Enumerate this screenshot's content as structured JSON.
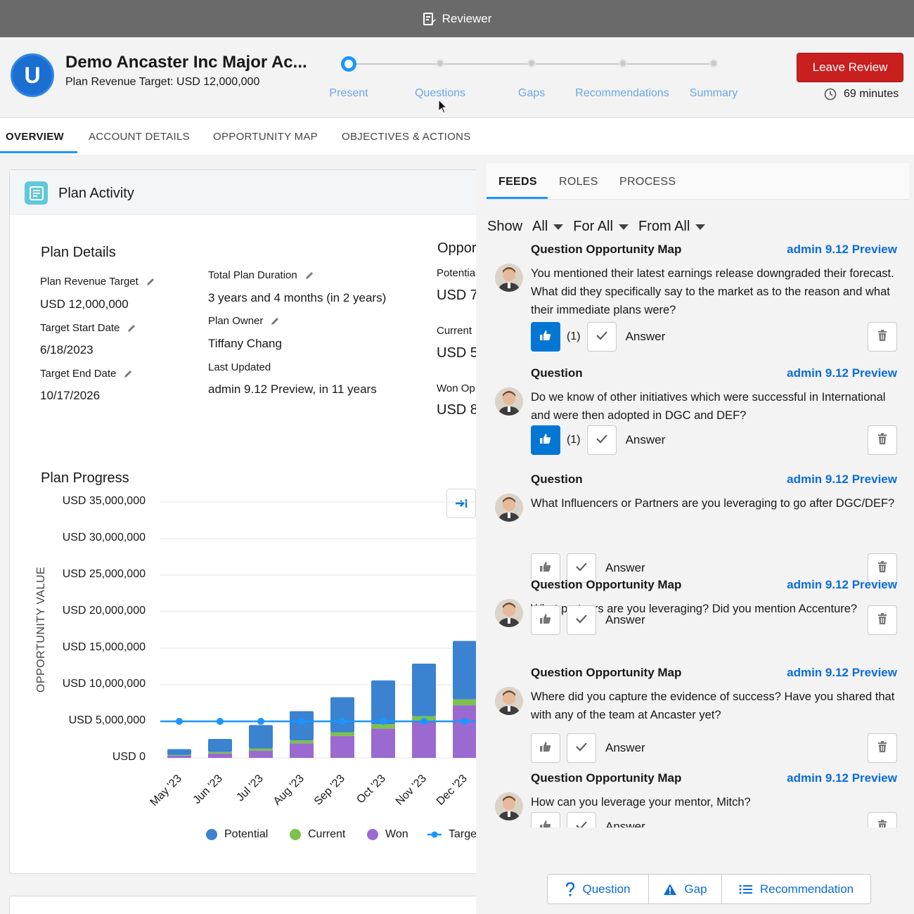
{
  "window": {
    "title": "Reviewer"
  },
  "header": {
    "logo_letter": "U",
    "account_title": "Demo Ancaster Inc Major Ac...",
    "subtitle": "Plan Revenue Target: USD 12,000,000",
    "steps": [
      "Present",
      "Questions",
      "Gaps",
      "Recommendations",
      "Summary"
    ],
    "active_step": 0,
    "leave_review": "Leave Review",
    "timer": "69 minutes"
  },
  "main_tabs": [
    "OVERVIEW",
    "ACCOUNT DETAILS",
    "OPPORTUNITY MAP",
    "OBJECTIVES & ACTIONS"
  ],
  "plan_activity": {
    "title": "Plan Activity",
    "details_heading": "Plan Details",
    "revenue_target_label": "Plan Revenue Target",
    "revenue_target_value": "USD 12,000,000",
    "start_label": "Target Start Date",
    "start_value": "6/18/2023",
    "end_label": "Target End Date",
    "end_value": "10/17/2026",
    "duration_label": "Total Plan Duration",
    "duration_value": "3 years and 4 months (in 2 years)",
    "owner_label": "Plan Owner",
    "owner_value": "Tiffany Chang",
    "updated_label": "Last Updated",
    "updated_value": "admin 9.12 Preview, in 11 years",
    "opp_heading": "Oppor",
    "potential_label": "Potentia",
    "potential_value": "USD 7",
    "current_label": "Current",
    "current_value": "USD 5",
    "won_label": "Won Op",
    "won_value": "USD 8"
  },
  "chart_data": {
    "type": "bar",
    "title": "Plan Progress",
    "ylabel": "OPPORTUNITY VALUE",
    "ylim": [
      0,
      35000000
    ],
    "ytick_labels": [
      "USD 35,000,000",
      "USD 30,000,000",
      "USD 25,000,000",
      "USD 20,000,000",
      "USD 15,000,000",
      "USD 10,000,000",
      "USD 5,000,000",
      "USD 0"
    ],
    "categories": [
      "May '23",
      "Jun '23",
      "Jul '23",
      "Aug '23",
      "Sep '23",
      "Oct '23",
      "Nov '23",
      "Dec '23"
    ],
    "stacked": true,
    "series": [
      {
        "name": "Won",
        "color": "#9b6ad0",
        "values": [
          300000,
          600000,
          1000000,
          2000000,
          3000000,
          4000000,
          5000000,
          7200000
        ]
      },
      {
        "name": "Current",
        "color": "#7cc14a",
        "values": [
          100000,
          200000,
          300000,
          400000,
          500000,
          600000,
          700000,
          800000
        ]
      },
      {
        "name": "Potential",
        "color": "#3b82d1",
        "values": [
          800000,
          1800000,
          3200000,
          4000000,
          4800000,
          6000000,
          7200000,
          8000000
        ]
      }
    ],
    "target": {
      "name": "Target",
      "color": "#1b96ff",
      "value": 5000000
    },
    "legend": [
      "Potential",
      "Current",
      "Won",
      "Targe"
    ]
  },
  "feed_panel": {
    "tabs": [
      "FEEDS",
      "ROLES",
      "PROCESS"
    ],
    "filters": {
      "show_label": "Show",
      "show_value": "All",
      "for": "For All",
      "from": "From All"
    },
    "answer_label": "Answer",
    "items": [
      {
        "type": "Question Opportunity Map",
        "author": "admin 9.12 Preview",
        "text": "You mentioned their latest earnings release downgraded their forecast. What did they specifically say to the market as to the reason and what their immediate plans were?",
        "liked": true,
        "count": "(1)"
      },
      {
        "type": "Question",
        "author": "admin 9.12 Preview",
        "text": "Do we know of other initiatives which were successful in International and were then adopted in DGC and DEF?",
        "liked": true,
        "count": "(1)"
      },
      {
        "type": "Question",
        "author": "admin 9.12 Preview",
        "text": "What Influencers or Partners are you leveraging to go after DGC/DEF?",
        "liked": false,
        "count": ""
      },
      {
        "type": "Question Opportunity Map",
        "author": "admin 9.12 Preview",
        "text": "What partners are you leveraging? Did you mention Accenture?",
        "liked": false,
        "count": ""
      },
      {
        "type": "Question Opportunity Map",
        "author": "admin 9.12 Preview",
        "text": "Where did you capture the evidence of success? Have you shared that with any of the team at Ancaster yet?",
        "liked": false,
        "count": ""
      },
      {
        "type": "Question Opportunity Map",
        "author": "admin 9.12 Preview",
        "text": "How can you leverage your mentor, Mitch?",
        "liked": false,
        "count": ""
      }
    ]
  },
  "bottom_actions": [
    "Question",
    "Gap",
    "Recommendation"
  ],
  "colors": {
    "accent": "#1b96ff",
    "leave_review": "#c91f1f",
    "link": "#0b6cd8"
  }
}
